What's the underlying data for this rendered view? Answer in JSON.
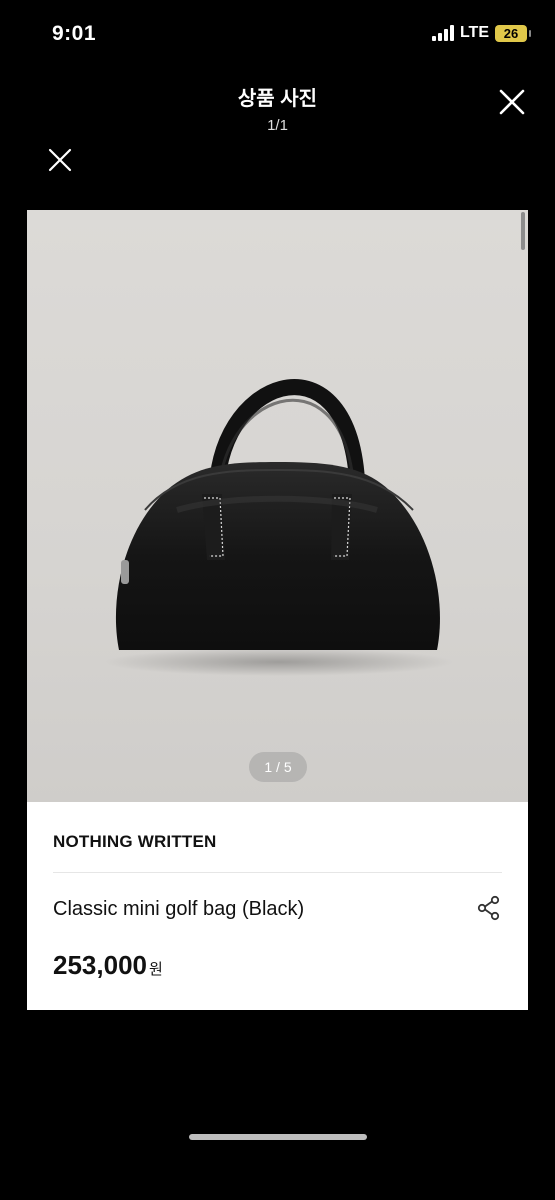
{
  "status": {
    "time": "9:01",
    "network": "LTE",
    "battery": "26"
  },
  "viewer": {
    "title": "상품 사진",
    "counter": "1/1"
  },
  "product": {
    "image_counter": "1 / 5",
    "brand": "NOTHING WRITTEN",
    "name": "Classic mini golf bag (Black)",
    "price": "253,000",
    "currency": "원"
  },
  "icons": {
    "close": "close-icon",
    "share": "share-icon",
    "signal": "signal-icon",
    "battery": "battery-icon"
  }
}
